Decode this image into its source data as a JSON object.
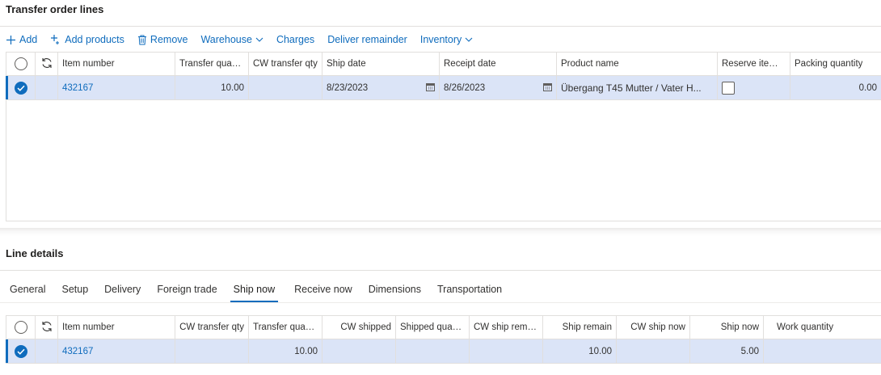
{
  "transfer_order_lines": {
    "title": "Transfer order lines",
    "toolbar": {
      "add": "Add",
      "add_products": "Add products",
      "remove": "Remove",
      "warehouse": "Warehouse",
      "charges": "Charges",
      "deliver_remainder": "Deliver remainder",
      "inventory": "Inventory"
    },
    "columns": {
      "item_number": "Item number",
      "transfer_quantity": "Transfer quanti...",
      "cw_transfer_qty": "CW transfer qty",
      "ship_date": "Ship date",
      "receipt_date": "Receipt date",
      "product_name": "Product name",
      "reserve_items": "Reserve items ...",
      "packing_quantity": "Packing quantity"
    },
    "rows": [
      {
        "item_number": "432167",
        "transfer_quantity": "10.00",
        "cw_transfer_qty": "",
        "ship_date": "8/23/2023",
        "receipt_date": "8/26/2023",
        "product_name": "Übergang T45 Mutter / Vater H...",
        "packing_quantity": "0.00"
      }
    ]
  },
  "line_details": {
    "title": "Line details",
    "tabs": [
      "General",
      "Setup",
      "Delivery",
      "Foreign trade",
      "Ship now",
      "Receive now",
      "Dimensions",
      "Transportation"
    ],
    "active_tab": "Ship now",
    "columns": {
      "item_number": "Item number",
      "cw_transfer_qty": "CW transfer qty",
      "transfer_quantity": "Transfer quanti...",
      "cw_shipped": "CW shipped",
      "shipped_quantity": "Shipped quant...",
      "cw_ship_remain": "CW ship remain",
      "ship_remain": "Ship remain",
      "cw_ship_now": "CW ship now",
      "ship_now": "Ship now",
      "work_quantity": "Work quantity"
    },
    "rows": [
      {
        "item_number": "432167",
        "cw_transfer_qty": "",
        "transfer_quantity": "10.00",
        "cw_shipped": "",
        "shipped_quantity": "",
        "cw_ship_remain": "",
        "ship_remain": "10.00",
        "cw_ship_now": "",
        "ship_now": "5.00",
        "work_quantity": ""
      }
    ]
  },
  "colors": {
    "accent": "#0f6cbd",
    "selected_row": "#dbe4f7",
    "border": "#e1dfdd"
  }
}
